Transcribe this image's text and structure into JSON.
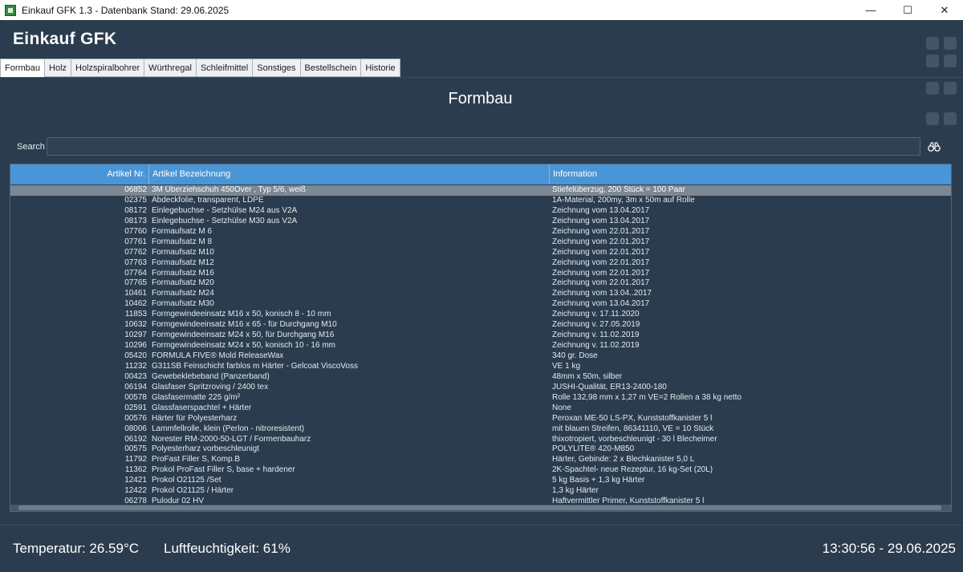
{
  "window": {
    "title": "Einkauf GFK 1.3 - Datenbank Stand: 29.06.2025",
    "minimize": "—",
    "maximize": "☐",
    "close": "✕"
  },
  "app": {
    "title": "Einkauf GFK"
  },
  "tabs": [
    {
      "label": "Formbau",
      "active": true
    },
    {
      "label": "Holz"
    },
    {
      "label": "Holzspiralbohrer"
    },
    {
      "label": "Würthregal"
    },
    {
      "label": "Schleifmittel"
    },
    {
      "label": "Sonstiges"
    },
    {
      "label": "Bestellschein"
    },
    {
      "label": "Historie"
    }
  ],
  "page": {
    "heading": "Formbau"
  },
  "search": {
    "label": "Search",
    "value": "",
    "icon": "binoculars-icon"
  },
  "table": {
    "headers": {
      "artikel_nr": "Artikel Nr.",
      "bezeichnung": "Artikel Bezeichnung",
      "information": "Information"
    },
    "selected_index": 0,
    "rows": [
      [
        "06852",
        "3M Überziehschuh 450Over , Typ 5/6, weiß",
        "Stiefelüberzug, 200 Stück = 100 Paar"
      ],
      [
        "02375",
        "Abdeckfolie, transparent, LDPE",
        "1A-Material, 200my, 3m x 50m auf Rolle"
      ],
      [
        "08172",
        "Einlegebuchse - Setzhülse M24 aus V2A",
        "Zeichnung vom 13.04.2017"
      ],
      [
        "08173",
        "Einlegebuchse - Setzhülse M30 aus V2A",
        "Zeichnung vom 13.04.2017"
      ],
      [
        "07760",
        "Formaufsatz M 6",
        "Zeichnung vom 22.01.2017"
      ],
      [
        "07761",
        "Formaufsatz M 8",
        "Zeichnung vom 22.01.2017"
      ],
      [
        "07762",
        "Formaufsatz M10",
        "Zeichnung vom 22.01.2017"
      ],
      [
        "07763",
        "Formaufsatz M12",
        "Zeichnung vom 22.01.2017"
      ],
      [
        "07764",
        "Formaufsatz M16",
        "Zeichnung vom 22.01.2017"
      ],
      [
        "07765",
        "Formaufsatz M20",
        "Zeichnung vom 22.01.2017"
      ],
      [
        "10461",
        "Formaufsatz M24",
        "Zeichnung vom 13.04..2017"
      ],
      [
        "10462",
        "Formaufsatz M30",
        "Zeichnung vom 13.04.2017"
      ],
      [
        "11853",
        "Formgewindeeinsatz M16 x 50, konisch 8 - 10 mm",
        "Zeichnung v. 17.11.2020"
      ],
      [
        "10632",
        "Formgewindeeinsatz M16 x 65 - für Durchgang M10",
        "Zeichnung v. 27.05.2019"
      ],
      [
        "10297",
        "Formgewindeeinsatz M24 x 50,  für Durchgang M16",
        "Zeichnung v. 11.02.2019"
      ],
      [
        "10296",
        "Formgewindeeinsatz M24 x 50, konisch 10 - 16 mm",
        "Zeichnung v. 11.02.2019"
      ],
      [
        "05420",
        "FORMULA FIVE® Mold ReleaseWax",
        "340 gr. Dose"
      ],
      [
        "11232",
        "G311SB Feinschicht farblos m Härter - Gelcoat ViscoVoss",
        "VE 1 kg"
      ],
      [
        "00423",
        "Gewebeklebeband (Panzerband)",
        "48mm x 50m, silber"
      ],
      [
        "06194",
        "Glasfaser Spritzroving / 2400 tex",
        "JUSHI-Qualität, ER13-2400-180"
      ],
      [
        "00578",
        "Glasfasermatte 225 g/m²",
        "Rolle 132,98 mm x 1,27 m VE=2 Rollen a 38 kg netto"
      ],
      [
        "02591",
        "Glassfaserspachtel + Härter",
        "None"
      ],
      [
        "00576",
        "Härter für Polyesterharz",
        "Peroxan ME-50 LS-PX, Kunststoffkanister 5 l"
      ],
      [
        "08006",
        "Lammfellrolle, klein (Perlon - nitroresistent)",
        "mit blauen Streifen, 86341110, VE = 10 Stück"
      ],
      [
        "06192",
        "Norester RM-2000-50-LGT / Formenbauharz",
        "thixotropiert, vorbeschleunigt - 30 l Blecheimer"
      ],
      [
        "00575",
        "Polyesterharz vorbeschleunigt",
        "POLYLITE® 420-M850"
      ],
      [
        "11792",
        "ProFast Filler S, Komp.B",
        "Härter, Gebinde: 2 x Blechkanister 5,0 L"
      ],
      [
        "11362",
        "Prokol ProFast Filler S, base + hardener",
        "2K-Spachtel- neue Rezeptur, 16 kg-Set (20L)"
      ],
      [
        "12421",
        "Prokol O21125 /Set",
        "5 kg Basis + 1,3 kg Härter"
      ],
      [
        "12422",
        "Prokol O21125 / Härter",
        "1,3 kg Härter"
      ],
      [
        "06278",
        "Pulodur 02 HV",
        "Haftvermittler Primer, Kunststoffkanister 5 l"
      ]
    ]
  },
  "status": {
    "temperature": "Temperatur: 26.59°C",
    "humidity": "Luftfeuchtigkeit: 61%",
    "datetime": "13:30:56 - 29.06.2025"
  }
}
